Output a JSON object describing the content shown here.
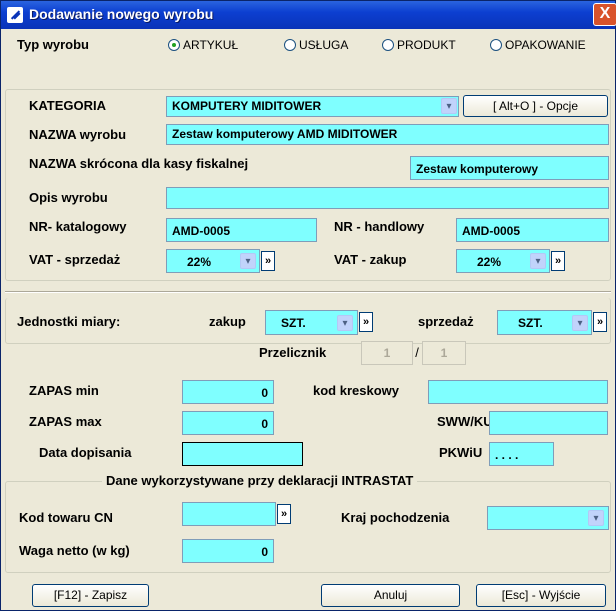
{
  "window": {
    "title": "Dodawanie nowego wyrobu",
    "close": "X"
  },
  "typ": {
    "label": "Typ wyrobu",
    "options": [
      "ARTYKUŁ",
      "USŁUGA",
      "PRODUKT",
      "OPAKOWANIE"
    ],
    "selected": "ARTYKUŁ"
  },
  "kategoria": {
    "label": "KATEGORIA",
    "value": "KOMPUTERY MIDITOWER",
    "options_btn": "[ Alt+O ] - Opcje"
  },
  "nazwa": {
    "label": "NAZWA wyrobu",
    "value": "Zestaw komputerowy AMD MIDITOWER"
  },
  "nazwa_skr": {
    "label": "NAZWA skrócona dla kasy fiskalnej",
    "value": "Zestaw komputerowy"
  },
  "opis": {
    "label": "Opis wyrobu",
    "value": ""
  },
  "nr_kat": {
    "label": "NR- katalogowy",
    "value": "AMD-0005"
  },
  "nr_handl": {
    "label": "NR - handlowy",
    "value": "AMD-0005"
  },
  "vat_sp": {
    "label": "VAT - sprzedaż",
    "value": "22%"
  },
  "vat_zak": {
    "label": "VAT - zakup",
    "value": "22%"
  },
  "jm": {
    "label": "Jednostki miary:",
    "zakup_label": "zakup",
    "zakup_value": "SZT.",
    "sprzedaz_label": "sprzedaż",
    "sprzedaz_value": "SZT.",
    "przelicznik_label": "Przelicznik",
    "przel_a": "1",
    "przel_sep": "/",
    "przel_b": "1"
  },
  "zapas_min": {
    "label": "ZAPAS min",
    "value": "0"
  },
  "zapas_max": {
    "label": "ZAPAS max",
    "value": "0"
  },
  "data_dop": {
    "label": "Data dopisania",
    "value": ""
  },
  "kod_kresk": {
    "label": "kod kreskowy",
    "value": ""
  },
  "sww": {
    "label": "SWW/KU",
    "value": ""
  },
  "pkwiu": {
    "label": "PKWiU",
    "value": ". . . ."
  },
  "intrastat": {
    "heading": "Dane wykorzystywane przy deklaracji INTRASTAT",
    "kod_cn_label": "Kod towaru CN",
    "kod_cn_value": "",
    "kraj_label": "Kraj pochodzenia",
    "kraj_value": "",
    "waga_label": "Waga netto (w kg)",
    "waga_value": "0"
  },
  "buttons": {
    "save": "[F12] - Zapisz",
    "cancel": "Anuluj",
    "exit": "[Esc] - Wyjście"
  },
  "icons": {
    "dropdown": "▾",
    "more": "»",
    "title": "app-icon"
  }
}
